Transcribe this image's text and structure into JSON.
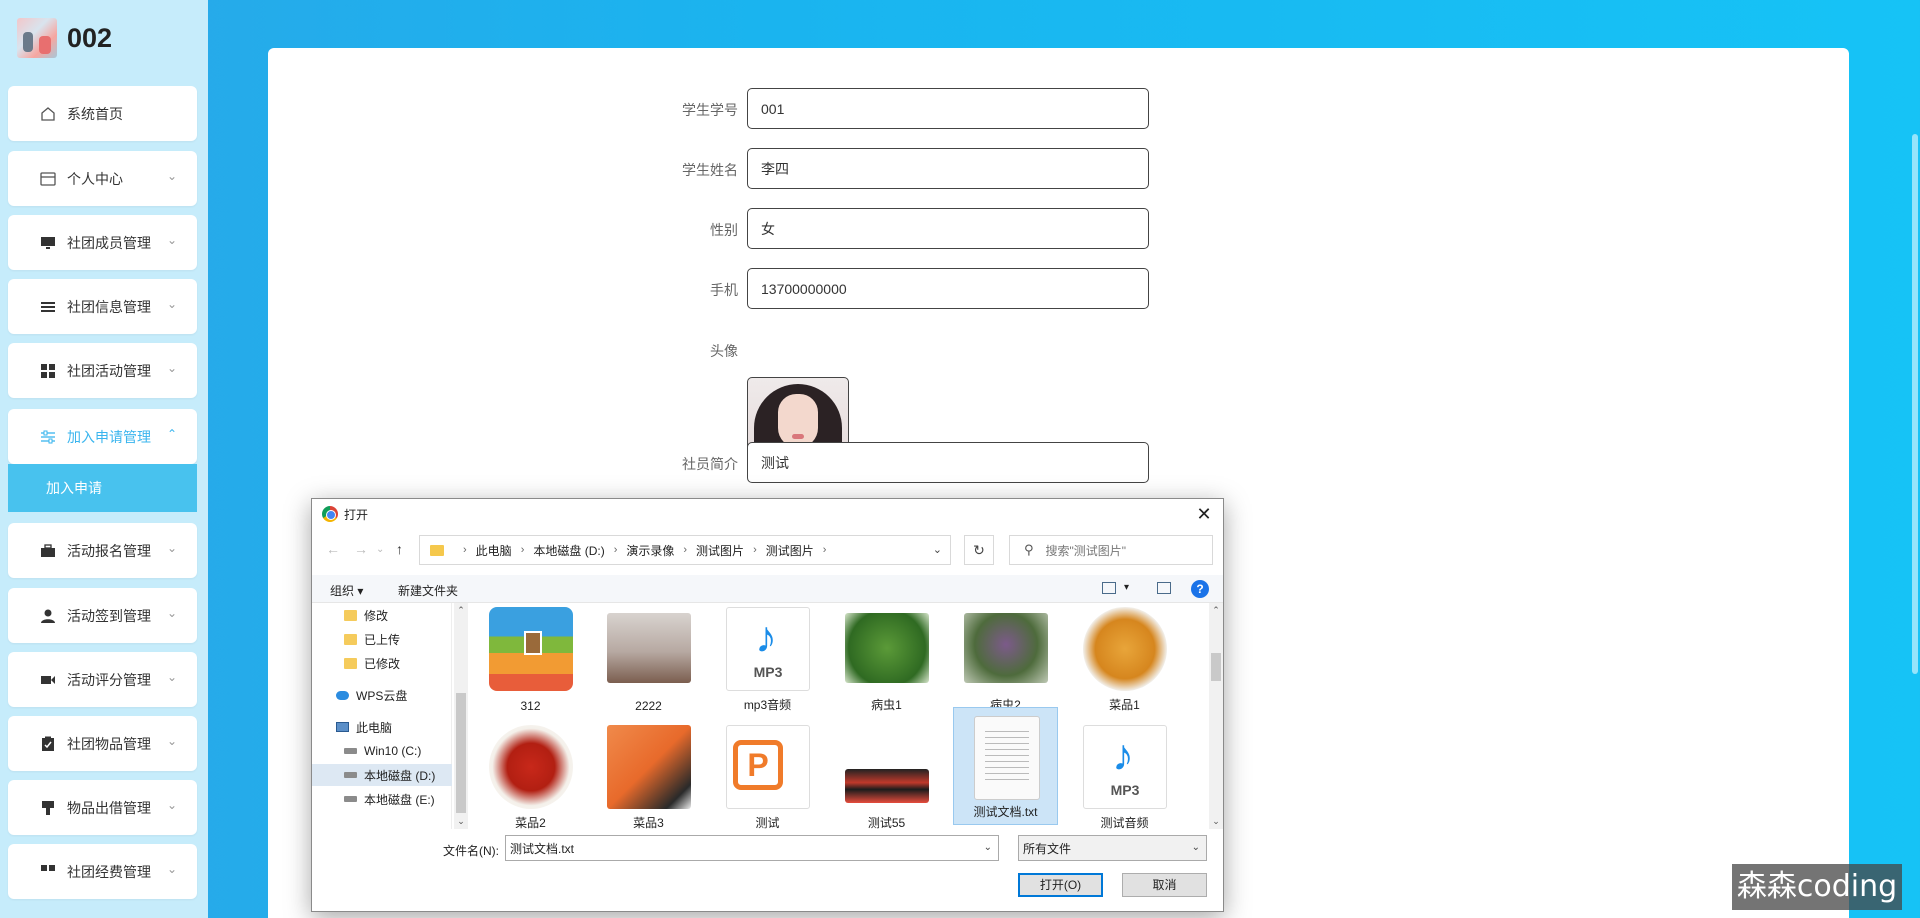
{
  "brand": {
    "name": "002"
  },
  "sidebar": {
    "items": [
      {
        "label": "系统首页",
        "icon": "home-icon",
        "has_chevron": false
      },
      {
        "label": "个人中心",
        "icon": "card-icon",
        "has_chevron": true
      },
      {
        "label": "社团成员管理",
        "icon": "monitor-icon",
        "has_chevron": true
      },
      {
        "label": "社团信息管理",
        "icon": "list-icon",
        "has_chevron": true
      },
      {
        "label": "社团活动管理",
        "icon": "grid-icon",
        "has_chevron": true
      },
      {
        "label": "加入申请管理",
        "icon": "sliders-icon",
        "has_chevron": true,
        "active": true
      },
      {
        "label": "活动报名管理",
        "icon": "briefcase-icon",
        "has_chevron": true
      },
      {
        "label": "活动签到管理",
        "icon": "user-icon",
        "has_chevron": true
      },
      {
        "label": "活动评分管理",
        "icon": "video-icon",
        "has_chevron": true
      },
      {
        "label": "社团物品管理",
        "icon": "clipboard-icon",
        "has_chevron": true
      },
      {
        "label": "物品出借管理",
        "icon": "stamp-icon",
        "has_chevron": true
      },
      {
        "label": "社团经费管理",
        "icon": "grid-icon",
        "has_chevron": true
      }
    ],
    "sub_item": "加入申请"
  },
  "form": {
    "student_id": {
      "label": "学生学号",
      "value": "001"
    },
    "student_name": {
      "label": "学生姓名",
      "value": "李四"
    },
    "gender": {
      "label": "性别",
      "value": "女"
    },
    "phone": {
      "label": "手机",
      "value": "13700000000"
    },
    "avatar": {
      "label": "头像"
    },
    "intro": {
      "label": "社员简介",
      "value": "测试"
    }
  },
  "dialog": {
    "title": "打开",
    "breadcrumb": [
      "此电脑",
      "本地磁盘 (D:)",
      "演示录像",
      "测试图片",
      "测试图片"
    ],
    "search_placeholder": "搜索\"测试图片\"",
    "toolbar": {
      "organize": "组织 ▾",
      "new_folder": "新建文件夹"
    },
    "nav_tree": [
      {
        "label": "修改",
        "icon": "folder-icon"
      },
      {
        "label": "已上传",
        "icon": "folder-icon"
      },
      {
        "label": "已修改",
        "icon": "folder-icon"
      },
      {
        "label": "WPS云盘",
        "icon": "cloud-icon"
      },
      {
        "label": "此电脑",
        "icon": "computer-icon"
      },
      {
        "label": "Win10 (C:)",
        "icon": "drive-icon"
      },
      {
        "label": "本地磁盘 (D:)",
        "icon": "drive-icon",
        "selected": true
      },
      {
        "label": "本地磁盘 (E:)",
        "icon": "drive-icon"
      }
    ],
    "files": [
      {
        "name": "312",
        "kind": "zip"
      },
      {
        "name": "2222",
        "kind": "photo-bottles"
      },
      {
        "name": "mp3音频",
        "kind": "mp3"
      },
      {
        "name": "病虫1",
        "kind": "leaf"
      },
      {
        "name": "病虫2",
        "kind": "worm"
      },
      {
        "name": "菜品1",
        "kind": "dish1"
      },
      {
        "name": "菜品2",
        "kind": "dish2"
      },
      {
        "name": "菜品3",
        "kind": "dish3"
      },
      {
        "name": "测试",
        "kind": "ppt"
      },
      {
        "name": "测试55",
        "kind": "video"
      },
      {
        "name": "测试文档.txt",
        "kind": "txt",
        "selected": true
      },
      {
        "name": "测试音频",
        "kind": "mp3"
      }
    ],
    "mp3_label": "MP3",
    "ppt_letter": "P",
    "filename_label": "文件名(N):",
    "filename_value": "测试文档.txt",
    "filetype_value": "所有文件",
    "open_button": "打开(O)",
    "cancel_button": "取消"
  },
  "watermark": "森森coding"
}
